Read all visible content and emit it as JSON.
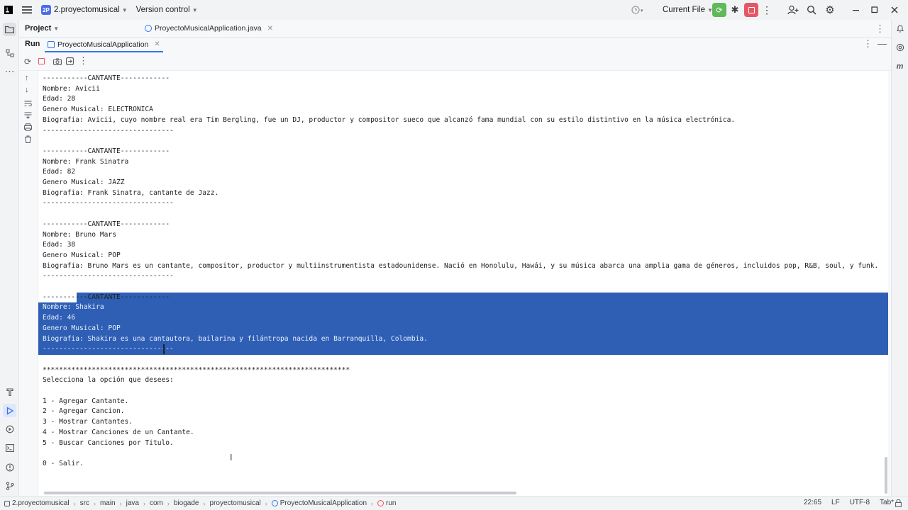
{
  "titlebar": {
    "project_badge": "2P",
    "project_name": "2.proyectomusical",
    "vcs": "Version control",
    "run_config": "Current File"
  },
  "project_row": {
    "panel_label": "Project",
    "editor_tab": "ProyectoMusicalApplication.java"
  },
  "run_row": {
    "run_label": "Run",
    "run_tab": "ProyectoMusicalApplication"
  },
  "console": {
    "lines": [
      "-----------CANTANTE------------",
      "Nombre: Avicii",
      "Edad: 28",
      "Genero Musical: ELECTRONICA",
      "Biografia: Avicii, cuyo nombre real era Tim Bergling, fue un DJ, productor y compositor sueco que alcanzó fama mundial con su estilo distintivo en la música electrónica.",
      "--------------------------------",
      "",
      "-----------CANTANTE------------",
      "Nombre: Frank Sinatra",
      "Edad: 82",
      "Genero Musical: JAZZ",
      "Biografia: Frank Sinatra, cantante de Jazz.",
      "--------------------------------",
      "",
      "-----------CANTANTE------------",
      "Nombre: Bruno Mars",
      "Edad: 38",
      "Genero Musical: POP",
      "Biografia: Bruno Mars es un cantante, compositor, productor y multiinstrumentista estadounidense. Nació en Honolulu, Hawái, y su música abarca una amplia gama de géneros, incluidos pop, R&B, soul, y funk.",
      "--------------------------------",
      "",
      "-----------CANTANTE------------",
      "Nombre: Shakira",
      "Edad: 46",
      "Genero Musical: POP",
      "Biografia: Shakira es una cantautora, bailarina y filántropa nacida en Barranquilla, Colombia.",
      "--------------------------------",
      "",
      "***************************************************************************",
      "Selecciona la opción que desees:",
      "",
      "1 - Agregar Cantante.",
      "2 - Agregar Cancion.",
      "3 - Mostrar Cantantes.",
      "4 - Mostrar Canciones de un Cantante.",
      "5 - Buscar Canciones por Titulo.",
      "",
      "0 - Salir."
    ]
  },
  "statusbar": {
    "breadcrumbs": [
      "2.proyectomusical",
      "src",
      "main",
      "java",
      "com",
      "biogade",
      "proyectomusical",
      "ProyectoMusicalApplication",
      "run"
    ],
    "cursor_pos": "22:65",
    "line_sep": "LF",
    "encoding": "UTF-8",
    "indent": "Tab*"
  },
  "colors": {
    "selection": "#2e5fb5",
    "run_green": "#5fb85a",
    "stop_red": "#e55765",
    "accent": "#4b6ee8"
  }
}
